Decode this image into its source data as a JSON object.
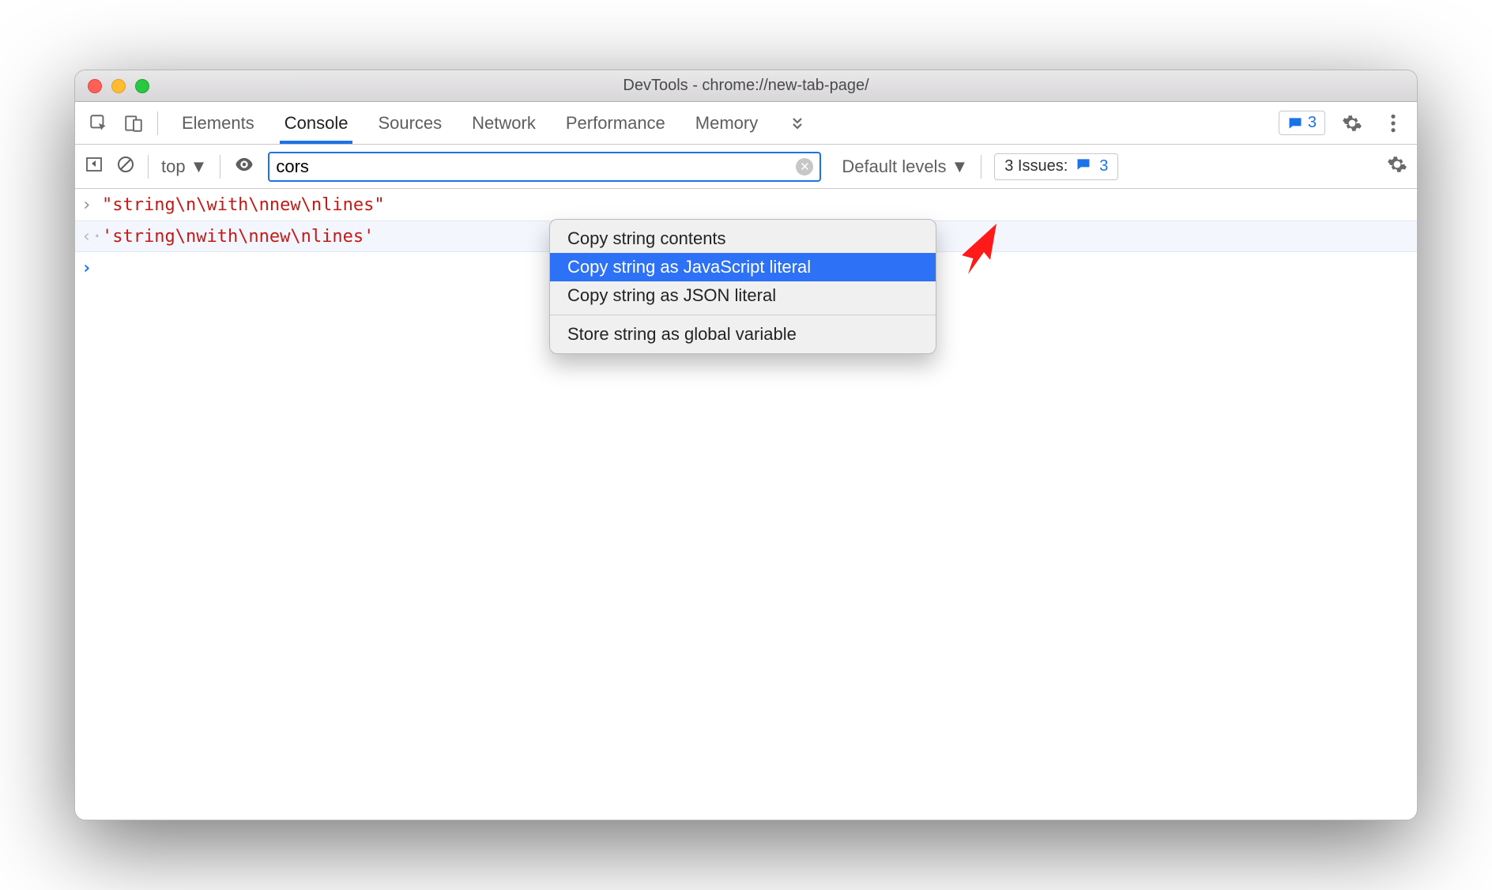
{
  "window": {
    "title": "DevTools - chrome://new-tab-page/"
  },
  "tabs": {
    "items": [
      "Elements",
      "Console",
      "Sources",
      "Network",
      "Performance",
      "Memory"
    ],
    "active": "Console",
    "messages_count": "3"
  },
  "toolbar": {
    "context": "top",
    "filter_value": "cors",
    "levels_label": "Default levels",
    "issues_label": "3 Issues:",
    "issues_count": "3"
  },
  "console": {
    "input_text": "\"string\\n\\with\\nnew\\nlines\"",
    "output_text": "'string\\nwith\\nnew\\nlines'"
  },
  "context_menu": {
    "items": [
      "Copy string contents",
      "Copy string as JavaScript literal",
      "Copy string as JSON literal"
    ],
    "selected_index": 1,
    "group2": [
      "Store string as global variable"
    ]
  }
}
